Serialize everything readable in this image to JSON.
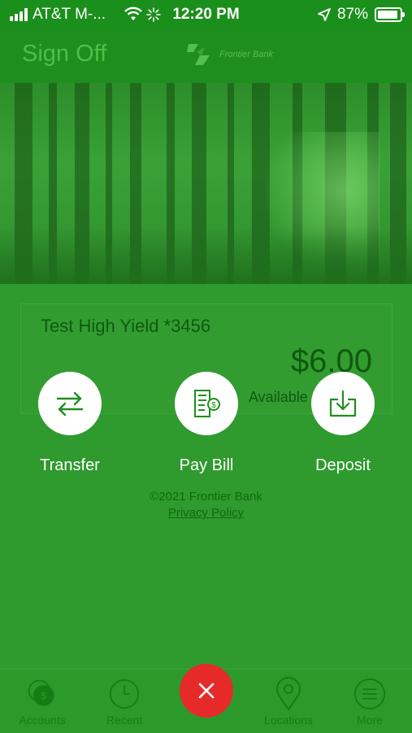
{
  "status_bar": {
    "carrier": "AT&T M-...",
    "time": "12:20 PM",
    "battery": "87%"
  },
  "header": {
    "sign_off": "Sign Off",
    "logo_text": "Frontier Bank"
  },
  "account": {
    "name": "Test High Yield *3456",
    "balance": "$6.00",
    "available_label": "Available"
  },
  "actions": [
    {
      "label": "Transfer",
      "icon": "transfer-arrows-icon"
    },
    {
      "label": "Pay Bill",
      "icon": "bill-icon"
    },
    {
      "label": "Deposit",
      "icon": "deposit-icon"
    }
  ],
  "footer": {
    "copyright": "©2021 Frontier Bank",
    "privacy": "Privacy Policy"
  },
  "tabbar": {
    "accounts": "Accounts",
    "recent": "Recent",
    "locations": "Locations",
    "more": "More"
  },
  "colors": {
    "overlay": "#2f9a2e",
    "close": "#e62a2a",
    "white": "#ffffff"
  }
}
